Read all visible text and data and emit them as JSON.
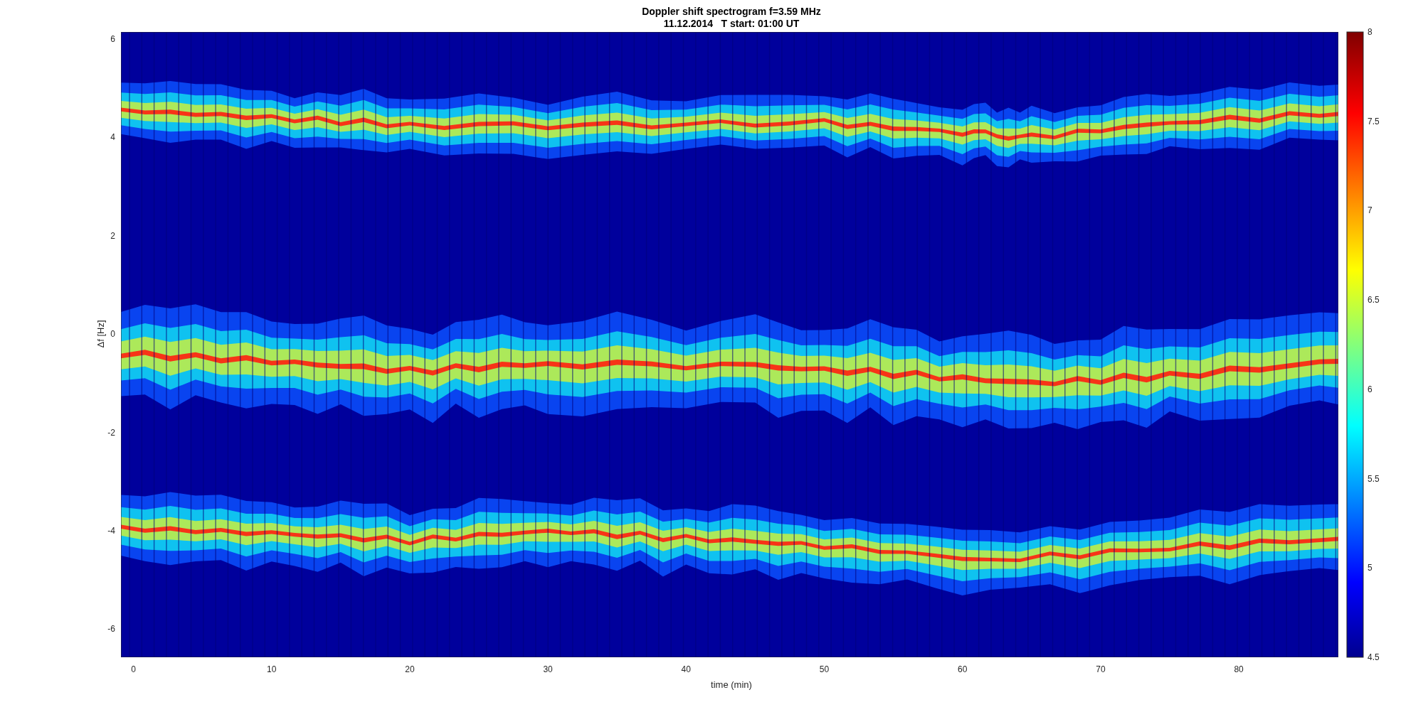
{
  "figure": {
    "title_lines": [
      "Doppler shift spectrogram f=3.59 MHz",
      "11.12.2014   T start: 01:00 UT"
    ]
  },
  "axes": {
    "ylabel": "Δf [Hz]",
    "xlabel": "time (min)",
    "yticks": [
      "6",
      "4",
      "2",
      "0",
      "-2",
      "-4",
      "-6"
    ],
    "xticks": [
      "0",
      "10",
      "20",
      "30",
      "40",
      "50",
      "60",
      "70",
      "80"
    ]
  },
  "colorbar": {
    "ticks": [
      "8",
      "7.5",
      "7",
      "6.5",
      "6",
      "5.5",
      "5",
      "4.5"
    ]
  }
}
